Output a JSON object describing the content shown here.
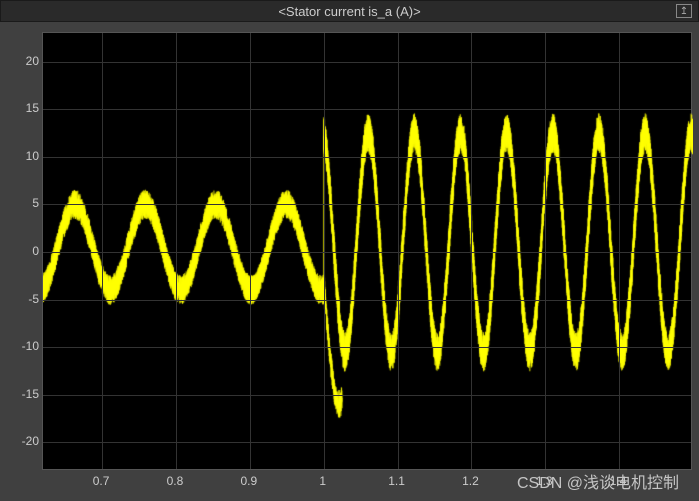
{
  "title": "<Stator current is_a (A)>",
  "watermark": "CSDN @浅谈电机控制",
  "chart_data": {
    "type": "line",
    "title": "<Stator current is_a (A)>",
    "xlabel": "",
    "ylabel": "",
    "xlim": [
      0.62,
      1.5
    ],
    "ylim": [
      -23,
      23
    ],
    "x_ticks": [
      0.7,
      0.8,
      0.9,
      1.0,
      1.1,
      1.2,
      1.3,
      1.4
    ],
    "y_ticks": [
      -20,
      -15,
      -10,
      -5,
      0,
      5,
      10,
      15,
      20
    ],
    "series": [
      {
        "name": "is_a",
        "color": "#ffff00",
        "segments": [
          {
            "range": [
              0.62,
              1.0
            ],
            "amplitude": 4.5,
            "offset": 0.5,
            "frequency": 10.5,
            "noise": 1.2
          },
          {
            "range": [
              1.0,
              1.5
            ],
            "amplitude": 11.5,
            "offset": 1.0,
            "frequency": 16.0,
            "noise": 1.6
          }
        ],
        "sample_points": [
          {
            "x": 0.7,
            "y": 0.0
          },
          {
            "x": 0.75,
            "y": 5.0
          },
          {
            "x": 0.8,
            "y": -3.5
          },
          {
            "x": 0.85,
            "y": 5.0
          },
          {
            "x": 0.9,
            "y": -3.5
          },
          {
            "x": 0.95,
            "y": 5.5
          },
          {
            "x": 1.0,
            "y": -3.0
          },
          {
            "x": 1.02,
            "y": -15.0
          },
          {
            "x": 1.05,
            "y": 14.0
          },
          {
            "x": 1.08,
            "y": -12.0
          },
          {
            "x": 1.11,
            "y": 13.0
          },
          {
            "x": 1.14,
            "y": -11.0
          },
          {
            "x": 1.17,
            "y": 13.0
          },
          {
            "x": 1.2,
            "y": -11.0
          },
          {
            "x": 1.24,
            "y": 13.0
          },
          {
            "x": 1.27,
            "y": -11.0
          },
          {
            "x": 1.3,
            "y": 13.0
          },
          {
            "x": 1.33,
            "y": -11.0
          },
          {
            "x": 1.36,
            "y": 13.0
          },
          {
            "x": 1.4,
            "y": -11.0
          },
          {
            "x": 1.43,
            "y": 13.0
          },
          {
            "x": 1.46,
            "y": -11.0
          },
          {
            "x": 1.49,
            "y": 13.0
          }
        ]
      }
    ]
  }
}
